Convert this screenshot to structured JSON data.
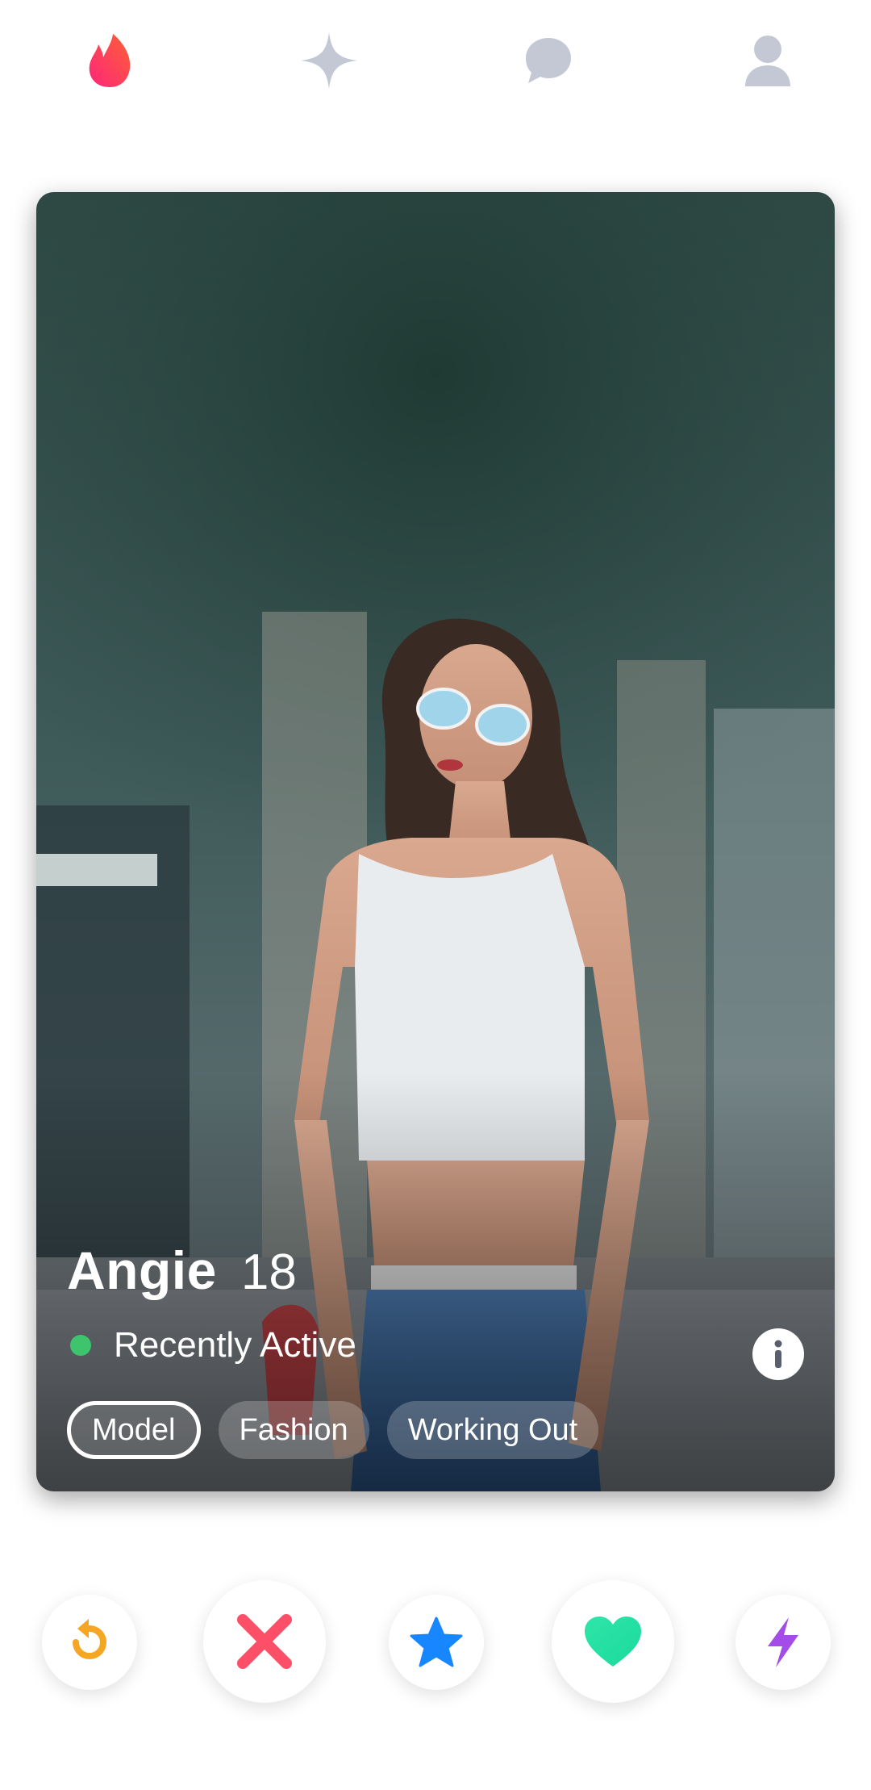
{
  "nav": {
    "items": [
      {
        "icon": "flame-icon",
        "active": true
      },
      {
        "icon": "sparkle-icon",
        "active": false
      },
      {
        "icon": "chat-icon",
        "active": false
      },
      {
        "icon": "profile-icon",
        "active": false
      }
    ],
    "colors": {
      "active_start": "#fd267a",
      "active_end": "#ff6036",
      "inactive": "#c3c8d4"
    }
  },
  "profile": {
    "name": "Angie",
    "age": "18",
    "status": "Recently Active",
    "status_color": "#3ec46d",
    "info_icon": "info-icon",
    "tags": [
      {
        "label": "Model",
        "selected": true
      },
      {
        "label": "Fashion",
        "selected": false
      },
      {
        "label": "Working Out",
        "selected": false
      }
    ]
  },
  "actions": [
    {
      "icon": "rewind-icon",
      "color": "#f5a623"
    },
    {
      "icon": "nope-x-icon",
      "color": "#fd5068"
    },
    {
      "icon": "super-like-star-icon",
      "color": "#1786ff"
    },
    {
      "icon": "like-heart-icon",
      "color": "#1bd99c"
    },
    {
      "icon": "boost-bolt-icon",
      "color": "#a34ce8"
    }
  ]
}
